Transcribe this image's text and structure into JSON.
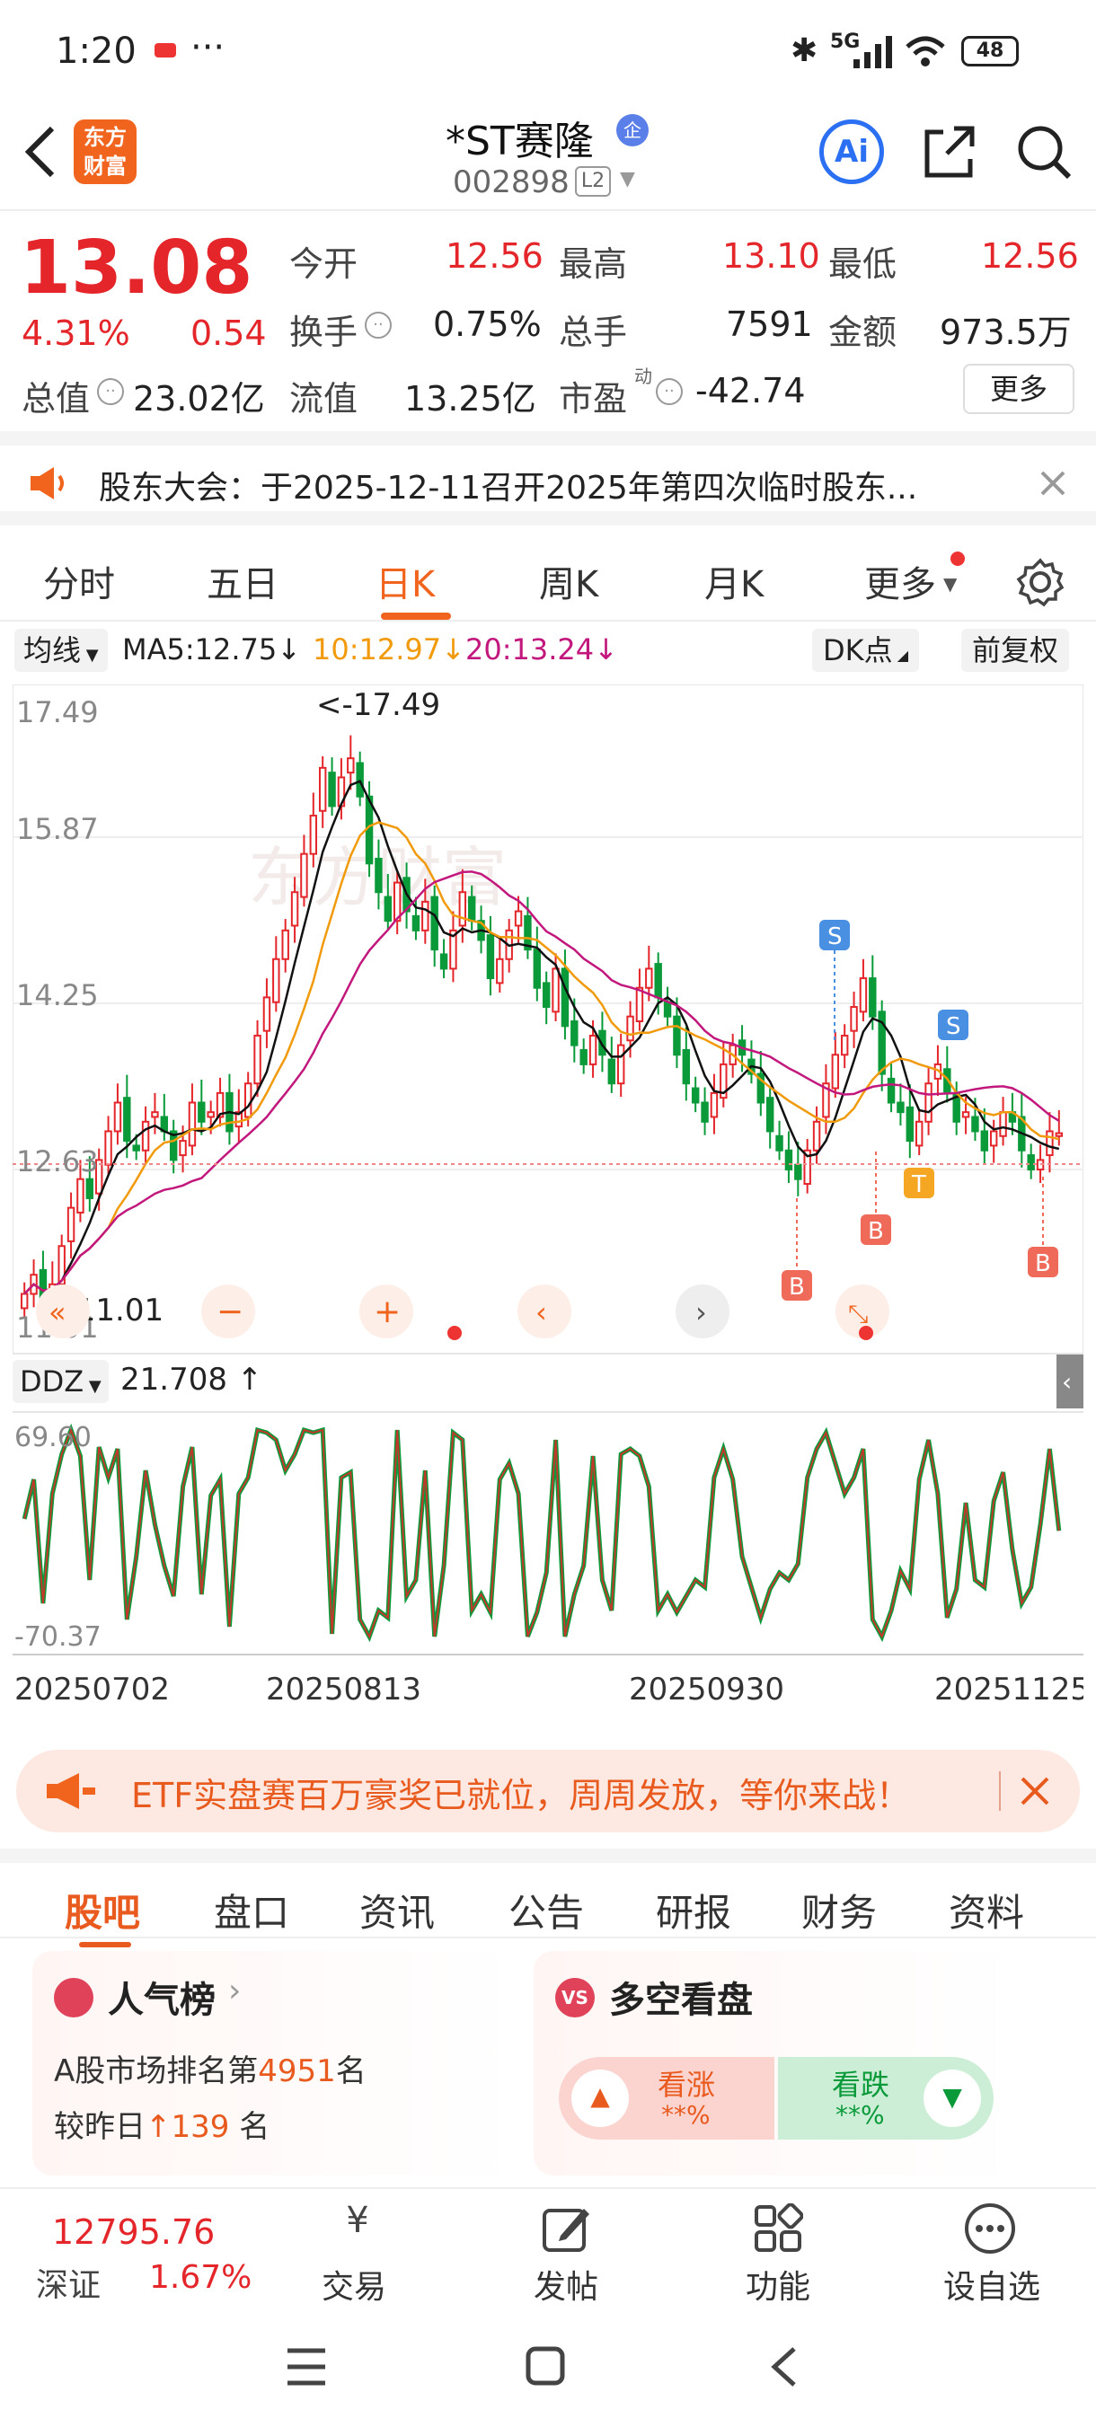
{
  "status": {
    "time": "1:20",
    "dots": "···",
    "network": "5G",
    "battery": "48"
  },
  "nav": {
    "app_logo_line1": "东方",
    "app_logo_line2": "财富",
    "title": "*ST赛隆",
    "badge": "企",
    "code": "002898",
    "level": "L2",
    "ai": "Ai"
  },
  "quote": {
    "price": "13.08",
    "pct": "4.31%",
    "change": "0.54",
    "jk_label": "今开",
    "jk": "12.56",
    "zg_label": "最高",
    "zg": "13.10",
    "zd_label": "最低",
    "zd": "12.56",
    "hs_label": "换手",
    "hs": "0.75%",
    "zs_label": "总手",
    "zs": "7591",
    "je_label": "金额",
    "je": "973.5万",
    "zz_label": "总值",
    "zz": "23.02亿",
    "lz_label": "流值",
    "lz": "13.25亿",
    "sy_label": "市盈",
    "sy_sup": "动",
    "sy": "-42.74",
    "more": "更多"
  },
  "notice": {
    "text": "股东大会：于2025-12-11召开2025年第四次临时股东..."
  },
  "tabs": [
    "分时",
    "五日",
    "日K",
    "周K",
    "月K",
    "更多"
  ],
  "chart_bar": {
    "ma_select": "均线",
    "ma5": "MA5:12.75",
    "ma10": "10:12.97",
    "ma20": "20:13.24",
    "arrow": "↓",
    "dk": "DK点",
    "fq": "前复权"
  },
  "chart_data": {
    "type": "candlestick",
    "yticks": [
      "17.49",
      "15.87",
      "14.25",
      "12.63",
      "11.01"
    ],
    "ylim": [
      11.01,
      17.49
    ],
    "high_label": "<-17.49",
    "low_label": "<-11.01",
    "last_close": 13.08,
    "markers": [
      "S",
      "S",
      "B",
      "B",
      "B",
      "T"
    ],
    "closes": [
      11.4,
      11.6,
      11.3,
      11.5,
      11.9,
      12.3,
      12.6,
      12.4,
      12.8,
      13.1,
      13.4,
      13.0,
      12.9,
      13.2,
      13.3,
      13.1,
      12.8,
      13.0,
      13.4,
      13.2,
      13.3,
      13.5,
      13.1,
      13.3,
      13.6,
      14.1,
      14.5,
      14.9,
      15.2,
      15.6,
      16.0,
      16.4,
      16.9,
      16.5,
      16.8,
      17.0,
      16.6,
      15.9,
      15.6,
      15.3,
      15.7,
      15.4,
      15.2,
      15.5,
      15.0,
      14.8,
      15.2,
      15.6,
      15.3,
      15.1,
      14.7,
      14.9,
      15.2,
      15.4,
      15.0,
      14.6,
      14.4,
      14.8,
      14.2,
      14.0,
      13.8,
      14.1,
      13.9,
      13.6,
      14.0,
      14.3,
      14.6,
      14.8,
      14.5,
      14.3,
      13.9,
      13.6,
      13.4,
      13.2,
      13.5,
      13.8,
      14.0,
      13.9,
      13.7,
      13.4,
      13.1,
      12.9,
      12.7,
      12.6,
      12.9,
      13.2,
      13.6,
      13.9,
      14.1,
      14.4,
      14.7,
      14.3,
      13.7,
      13.4,
      13.3,
      13.0,
      13.2,
      13.6,
      13.8,
      13.5,
      13.2,
      13.3,
      13.1,
      12.9,
      13.1,
      13.3,
      13.2,
      12.9,
      12.7,
      12.8,
      13.1,
      13.08
    ]
  },
  "ddz": {
    "label": "DDZ",
    "value": "21.708",
    "arrow": "↑",
    "top": "69.60",
    "bottom": "-70.37"
  },
  "xlabels": [
    "20250702",
    "20250813",
    "20250930",
    "20251125"
  ],
  "banner": {
    "text": "ETF实盘赛百万豪奖已就位，周周发放，等你来战！"
  },
  "bottom_tabs": [
    "股吧",
    "盘口",
    "资讯",
    "公告",
    "研报",
    "财务",
    "资料"
  ],
  "rank": {
    "title": "人气榜",
    "line1_pre": "A股市场排名第",
    "rank": "4951",
    "line1_post": "名",
    "line2_pre": "较昨日",
    "delta": "139",
    "line2_post": "名"
  },
  "vote": {
    "title": "多空看盘",
    "up": "看涨",
    "down": "看跌",
    "up_val": "**%",
    "down_val": "**%"
  },
  "dock": {
    "index_val": "12795.76",
    "index_name": "深证",
    "index_pct": "1.67%",
    "trade": "交易",
    "post": "发帖",
    "func": "功能",
    "watch": "设自选"
  }
}
